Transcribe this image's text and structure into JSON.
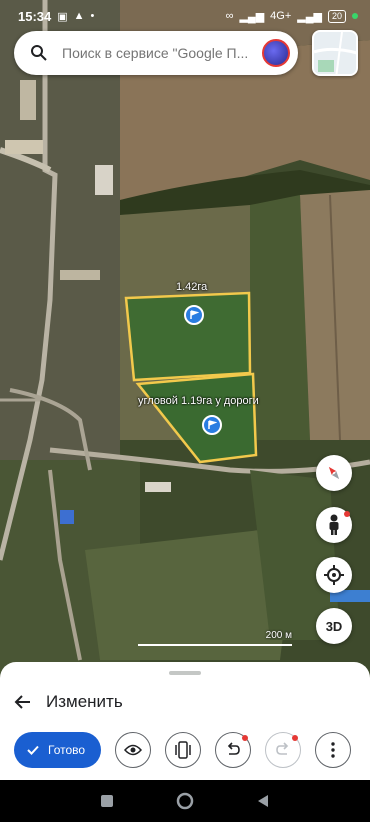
{
  "status_bar": {
    "time": "15:34",
    "network": "4G+",
    "battery": "20"
  },
  "search": {
    "placeholder": "Поиск в сервисе \"Google П..."
  },
  "map": {
    "fields": [
      {
        "label": "1.42га"
      },
      {
        "label": "угловой 1.19га у дороги"
      }
    ],
    "scale_label": "200 м",
    "three_d_label": "3D",
    "outline_color": "#f2c94c",
    "pin_color": "#2a7de1"
  },
  "sheet": {
    "title": "Изменить",
    "done_label": "Готово",
    "accent": "#1a5fd1"
  }
}
